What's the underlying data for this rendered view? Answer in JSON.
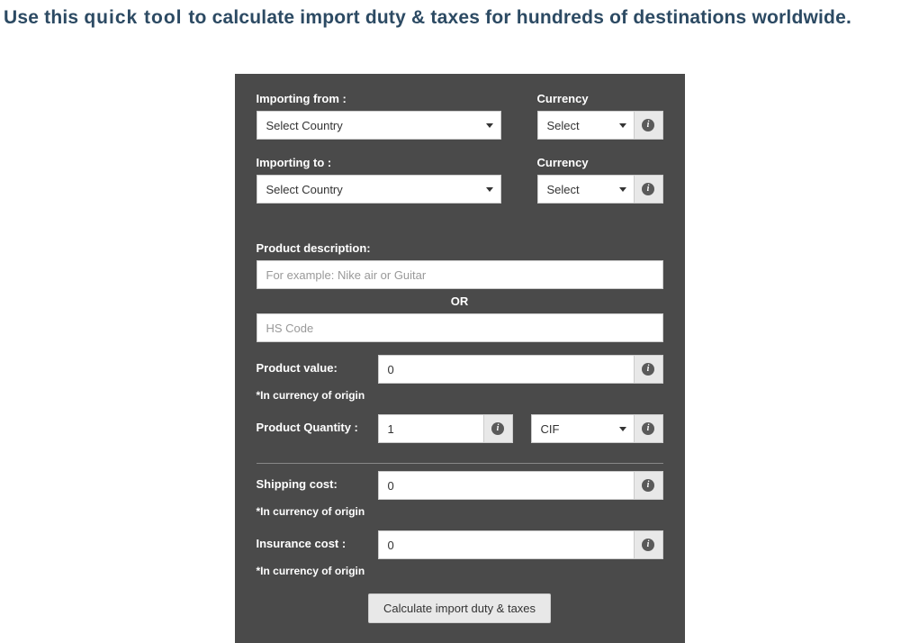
{
  "title_part1": "Use this ",
  "title_part2": "quick  tool ",
  "title_part3": " to calculate import duty & taxes for hundreds of destinations worldwide.",
  "importFrom": {
    "label": "Importing from :",
    "value": "Select Country"
  },
  "importTo": {
    "label": "Importing to :",
    "value": "Select Country"
  },
  "currencyFrom": {
    "label": "Currency",
    "value": "Select"
  },
  "currencyTo": {
    "label": "Currency",
    "value": "Select"
  },
  "productDesc": {
    "label": "Product description:",
    "placeholder": "For example: Nike air or Guitar"
  },
  "orText": "OR",
  "hsCode": {
    "placeholder": "HS Code"
  },
  "productValue": {
    "label": "Product value:",
    "value": "0",
    "note": "*In currency of origin"
  },
  "productQty": {
    "label": "Product Quantity :",
    "value": "1"
  },
  "terms": {
    "value": "CIF"
  },
  "shipping": {
    "label": "Shipping cost:",
    "value": "0",
    "note": "*In currency of origin"
  },
  "insurance": {
    "label": "Insurance cost :",
    "value": "0",
    "note": "*In currency of origin"
  },
  "calcBtn": "Calculate import duty & taxes",
  "infoGlyph": "i"
}
